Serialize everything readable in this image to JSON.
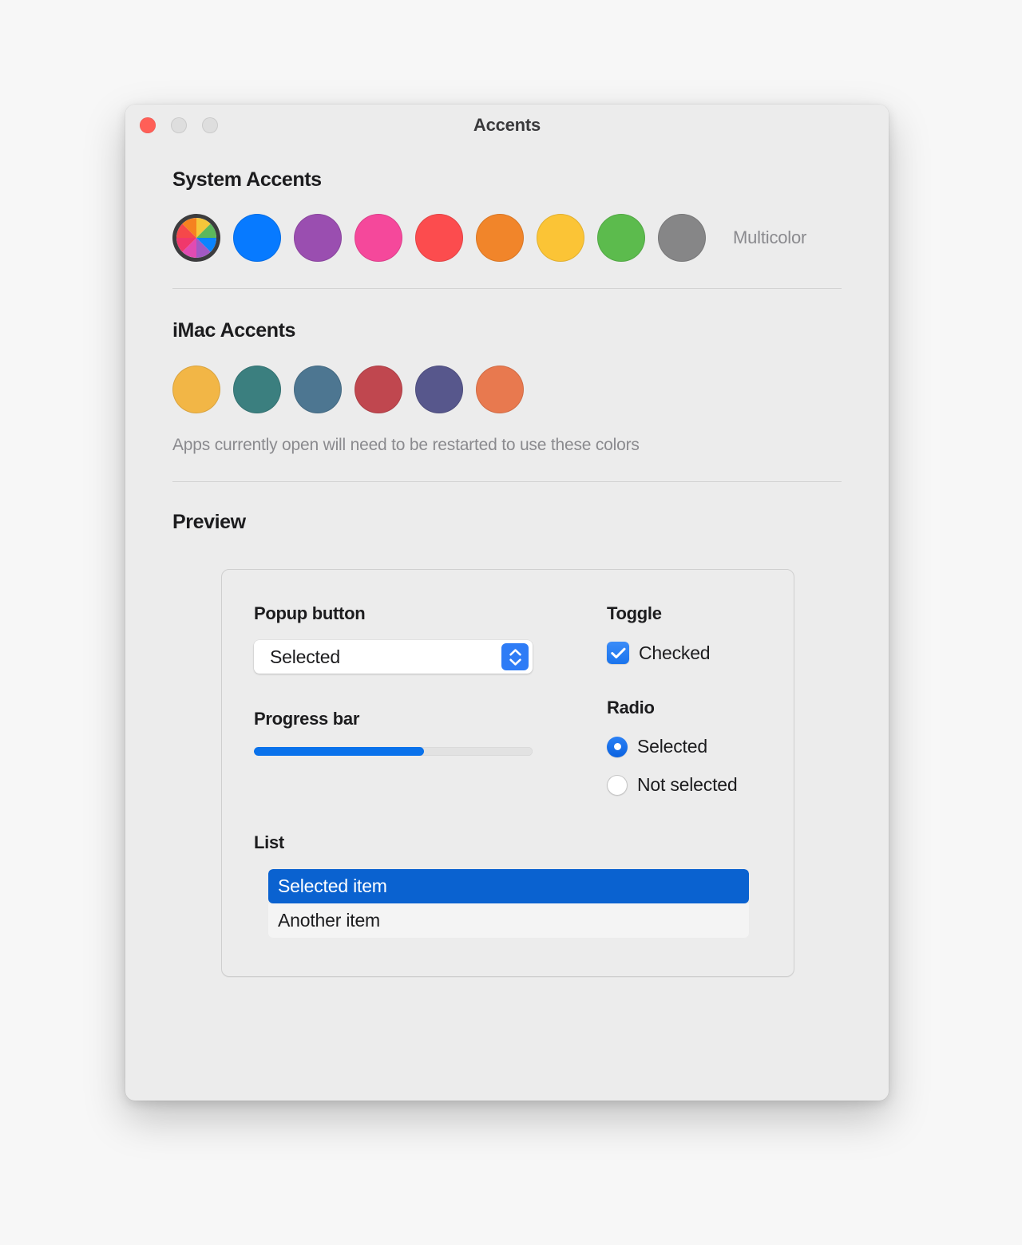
{
  "window": {
    "title": "Accents",
    "traffic_lights": [
      {
        "name": "close",
        "color": "#ff5f57"
      },
      {
        "name": "minimize",
        "color": "#dedede"
      },
      {
        "name": "maximize",
        "color": "#dedede"
      }
    ]
  },
  "system_accents": {
    "heading": "System Accents",
    "multicolor_label": "Multicolor",
    "swatches": [
      {
        "name": "multicolor",
        "selected": true,
        "color": "multicolor-wheel",
        "wheel_colors": [
          "#f5c63a",
          "#5cb85c",
          "#0a84ff",
          "#a259c4",
          "#e14bb2",
          "#f0386b",
          "#f5484a",
          "#f58220"
        ]
      },
      {
        "name": "blue",
        "selected": false,
        "color": "#077aff"
      },
      {
        "name": "purple",
        "selected": false,
        "color": "#9a4eb0"
      },
      {
        "name": "pink",
        "selected": false,
        "color": "#f5489b"
      },
      {
        "name": "red",
        "selected": false,
        "color": "#fc4c4e"
      },
      {
        "name": "orange",
        "selected": false,
        "color": "#f1852a"
      },
      {
        "name": "yellow",
        "selected": false,
        "color": "#fbc436"
      },
      {
        "name": "green",
        "selected": false,
        "color": "#5cbb4d"
      },
      {
        "name": "graphite",
        "selected": false,
        "color": "#868687"
      }
    ]
  },
  "imac_accents": {
    "heading": "iMac Accents",
    "note": "Apps currently open will need to be restarted to use these colors",
    "swatches": [
      {
        "name": "imac-yellow",
        "color": "#f2b646"
      },
      {
        "name": "imac-green",
        "color": "#3b7f7f"
      },
      {
        "name": "imac-blue",
        "color": "#4d7691"
      },
      {
        "name": "imac-red",
        "color": "#c0474f"
      },
      {
        "name": "imac-purple",
        "color": "#57578c"
      },
      {
        "name": "imac-orange",
        "color": "#e8794f"
      }
    ]
  },
  "preview": {
    "heading": "Preview",
    "popup": {
      "label": "Popup button",
      "value": "Selected",
      "options": [
        "Selected"
      ]
    },
    "progress": {
      "label": "Progress bar",
      "percent": 61,
      "fill_color": "#0a72eb"
    },
    "toggle": {
      "label": "Toggle",
      "checkbox_text": "Checked",
      "checked": true,
      "accent_color": "#1a74ed"
    },
    "radio": {
      "label": "Radio",
      "options": [
        {
          "text": "Selected",
          "checked": true
        },
        {
          "text": "Not selected",
          "checked": false
        }
      ]
    },
    "list": {
      "label": "List",
      "items": [
        {
          "text": "Selected item",
          "selected": true
        },
        {
          "text": "Another item",
          "selected": false
        }
      ],
      "selection_color": "#0a62d0"
    }
  }
}
